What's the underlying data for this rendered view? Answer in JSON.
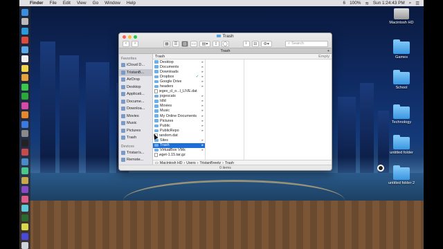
{
  "menubar": {
    "app_name": "Finder",
    "menus": [
      "File",
      "Edit",
      "View",
      "Go",
      "Window",
      "Help"
    ],
    "status_right": [
      "6",
      "100%",
      "Sun 1:24:43 PM"
    ]
  },
  "window": {
    "title": "Trash",
    "tab_label": "Trash",
    "search_placeholder": "Search",
    "column_header": "Trash",
    "empty_button": "Empty",
    "status": "0 items"
  },
  "sidebar": {
    "favorites_header": "Favorites",
    "favorites": [
      "iCloud D...",
      "TristanB...",
      "AirDrop",
      "Desktop",
      "Applicati...",
      "Docume...",
      "Downloa...",
      "Movies",
      "Music",
      "Pictures",
      "Trash"
    ],
    "devices_header": "Devices",
    "devices": [
      "Tristan's...",
      "Remote..."
    ]
  },
  "files": [
    {
      "name": "Desktop",
      "type": "folder"
    },
    {
      "name": "Documents",
      "type": "folder"
    },
    {
      "name": "Downloads",
      "type": "folder"
    },
    {
      "name": "Dropbox",
      "type": "folder",
      "badge": "✓"
    },
    {
      "name": "Google Drive",
      "type": "folder"
    },
    {
      "name": "headers",
      "type": "folder"
    },
    {
      "name": "jegex_cl_o...l_LIVE.dat",
      "type": "file"
    },
    {
      "name": "jogescats",
      "type": "folder"
    },
    {
      "name": "Idld",
      "type": "folder"
    },
    {
      "name": "Movies",
      "type": "folder"
    },
    {
      "name": "Music",
      "type": "folder"
    },
    {
      "name": "My Online Documents",
      "type": "folder"
    },
    {
      "name": "Pictures",
      "type": "folder"
    },
    {
      "name": "Public",
      "type": "folder"
    },
    {
      "name": "PublicRepo",
      "type": "folder"
    },
    {
      "name": "random.dat",
      "type": "file"
    },
    {
      "name": "Sites",
      "type": "folder"
    },
    {
      "name": "Trash",
      "type": "folder",
      "selected": true
    },
    {
      "name": "VirtualBox VMs",
      "type": "folder"
    },
    {
      "name": "wget-1.15.tar.gz",
      "type": "file"
    }
  ],
  "pathbar": [
    "Macintosh HD",
    "Users",
    "TristanBreetz",
    "Trash"
  ],
  "desktop_icons": [
    "Macintosh HD",
    "Games",
    "School",
    "Technology",
    "untitled folder",
    "untitled folder 2"
  ]
}
